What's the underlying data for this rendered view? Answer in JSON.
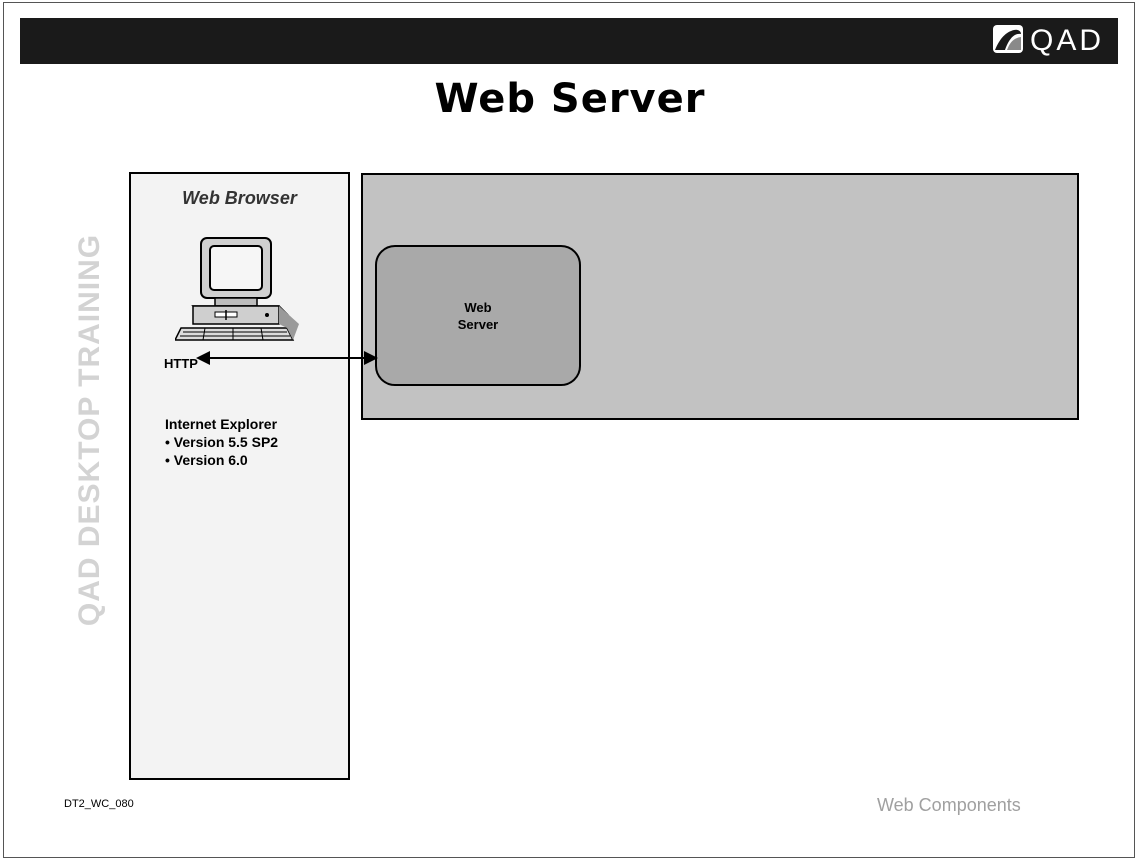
{
  "logo": {
    "text": "QAD",
    "icon": "qad-swoosh-icon"
  },
  "title": "Web Server",
  "watermark": "QAD DESKTOP TRAINING",
  "browser": {
    "title": "Web Browser",
    "icon": "desktop-computer-icon",
    "protocol": "HTTP",
    "software": "Internet Explorer",
    "versions": [
      "• Version 5.5 SP2",
      "• Version 6.0"
    ]
  },
  "server": {
    "line1": "Web",
    "line2": "Server"
  },
  "footer": {
    "slide_id": "DT2_WC_080",
    "section": "Web Components"
  },
  "colors": {
    "topbar": "#1a1a1a",
    "server_region": "#c2c2c2",
    "server_box": "#a9a9a9",
    "browser_panel": "#f3f3f3",
    "watermark": "#d3d3d3"
  }
}
